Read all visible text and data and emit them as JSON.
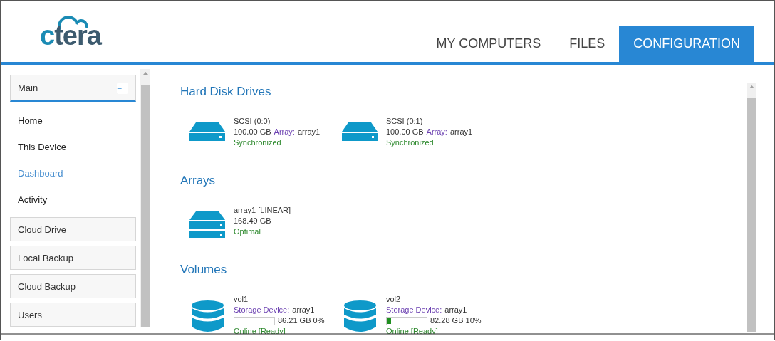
{
  "logo": {
    "text": "ctera"
  },
  "tabs": [
    {
      "label": "MY COMPUTERS",
      "selected": false
    },
    {
      "label": "FILES",
      "selected": false
    },
    {
      "label": "CONFIGURATION",
      "selected": true
    }
  ],
  "sidebar": {
    "groups": [
      {
        "label": "Main",
        "toggle": "−",
        "expanded": true,
        "items": [
          {
            "label": "Home",
            "selected": false
          },
          {
            "label": "This Device",
            "selected": false
          },
          {
            "label": "Dashboard",
            "selected": true
          },
          {
            "label": "Activity",
            "selected": false
          }
        ]
      },
      {
        "label": "Cloud Drive",
        "expanded": false
      },
      {
        "label": "Local Backup",
        "expanded": false
      },
      {
        "label": "Cloud Backup",
        "expanded": false
      },
      {
        "label": "Users",
        "expanded": false
      }
    ]
  },
  "sections": [
    {
      "title": "Hard Disk Drives",
      "kind": "disk",
      "items": [
        {
          "name": "SCSI (0:0)",
          "size": "100.00 GB",
          "ref_label": "Array:",
          "ref": "array1",
          "status": "Synchronized"
        },
        {
          "name": "SCSI (0:1)",
          "size": "100.00 GB",
          "ref_label": "Array:",
          "ref": "array1",
          "status": "Synchronized"
        }
      ]
    },
    {
      "title": "Arrays",
      "kind": "array",
      "items": [
        {
          "name": "array1 [LINEAR]",
          "size": "168.49 GB",
          "status": "Optimal"
        }
      ]
    },
    {
      "title": "Volumes",
      "kind": "volume",
      "items": [
        {
          "name": "vol1",
          "ref_label": "Storage Device:",
          "ref": "array1",
          "level": 0,
          "usage": "86.21 GB 0%",
          "status": "Online [Ready]"
        },
        {
          "name": "vol2",
          "ref_label": "Storage Device:",
          "ref": "array1",
          "level": 0.1,
          "usage": "82.28 GB 10%",
          "status": "Online [Ready]"
        }
      ]
    }
  ]
}
